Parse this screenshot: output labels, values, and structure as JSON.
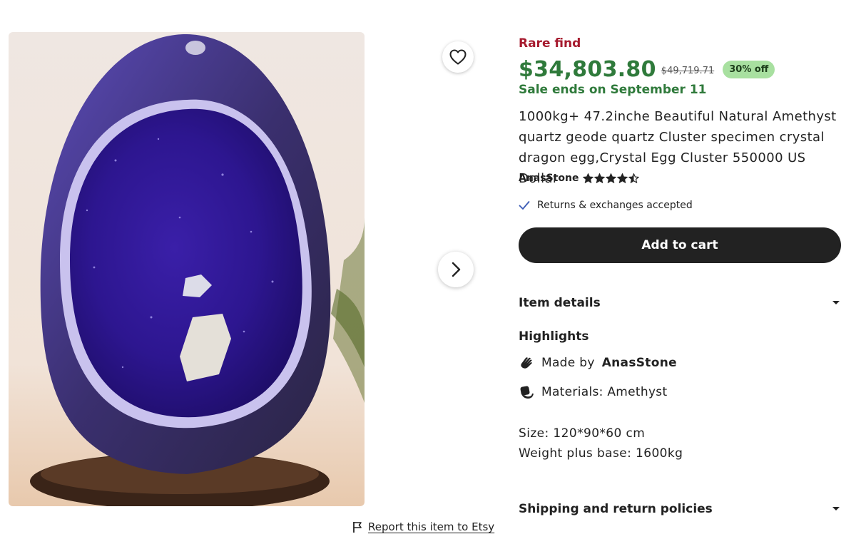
{
  "listing": {
    "rare_find": "Rare find",
    "price": "$34,803.80",
    "original_price": "$49,719.71",
    "discount": "30% off",
    "sale_ends": "Sale ends on September 11",
    "title": "1000kg+ 47.2inche Beautiful Natural Amethyst quartz geode quartz Cluster specimen crystal dragon egg,Crystal Egg Cluster 550000 US Dollar",
    "shop_name": "AnasStone",
    "rating": 4.5,
    "returns": "Returns & exchanges accepted",
    "add_to_cart": "Add to cart"
  },
  "item_details": {
    "label": "Item details",
    "highlights_title": "Highlights",
    "made_by_prefix": "Made by",
    "made_by_shop": "AnasStone",
    "materials": "Materials: Amethyst",
    "description_lines": [
      "Size: 120*90*60 cm",
      "Weight plus base: 1600kg"
    ]
  },
  "shipping": {
    "label": "Shipping and return policies"
  },
  "gallery": {
    "report_link": "Report this item to Etsy"
  },
  "colors": {
    "sale_green": "#2f7a3b",
    "rare_red": "#a61a2e",
    "discount_bg": "#a8e0a0",
    "button_dark": "#222222",
    "check_blue": "#3b5bb5"
  },
  "icons": {
    "favorite": "heart-icon",
    "next": "chevron-right-icon",
    "report": "flag-icon",
    "returns": "checkmark-icon",
    "made_by": "hand-wave-icon",
    "materials": "layers-icon",
    "expand": "chevron-down-icon"
  }
}
